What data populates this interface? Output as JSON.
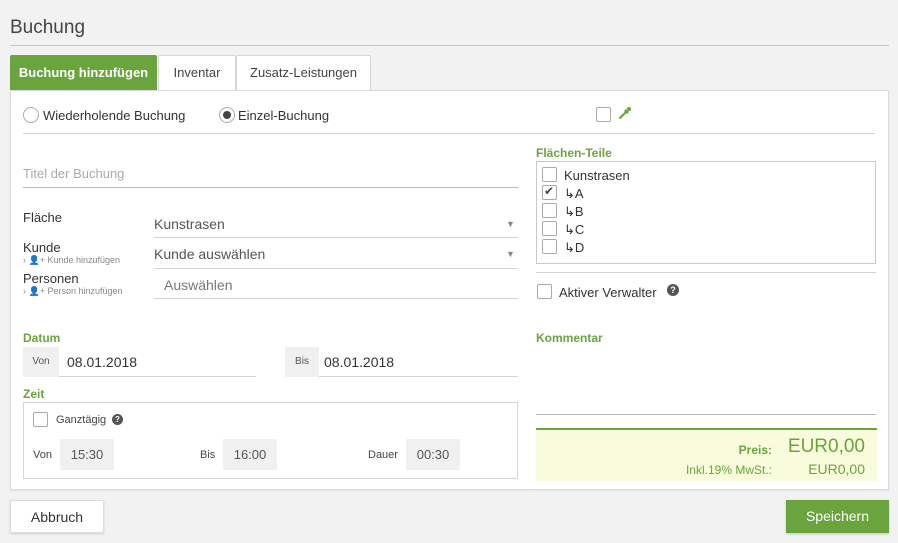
{
  "page": {
    "title": "Buchung"
  },
  "tabs": [
    {
      "label": "Buchung hinzufügen"
    },
    {
      "label": "Inventar"
    },
    {
      "label": "Zusatz-Leistungen"
    }
  ],
  "booking_type": {
    "recurring_label": "Wiederholende Buchung",
    "single_label": "Einzel-Buchung"
  },
  "title_field": {
    "placeholder": "Titel der Buchung"
  },
  "flaeche": {
    "label": "Fläche",
    "value": "Kunstrasen"
  },
  "kunde": {
    "label": "Kunde",
    "add_link": "Kunde hinzufügen",
    "value": "Kunde auswählen"
  },
  "personen": {
    "label": "Personen",
    "add_link": "Person hinzufügen",
    "placeholder": "Auswählen"
  },
  "datum": {
    "label": "Datum",
    "from_label": "Von",
    "from_value": "08.01.2018",
    "to_label": "Bis",
    "to_value": "08.01.2018"
  },
  "zeit": {
    "label": "Zeit",
    "allday_label": "Ganztägig",
    "from_label": "Von",
    "from_value": "15:30",
    "to_label": "Bis",
    "to_value": "16:00",
    "duration_label": "Dauer",
    "duration_value": "00:30"
  },
  "flaechen_teile": {
    "label": "Flächen-Teile",
    "items": [
      {
        "label": "Kunstrasen",
        "checked": false
      },
      {
        "label": "↳A",
        "checked": true
      },
      {
        "label": "↳B",
        "checked": false
      },
      {
        "label": "↳C",
        "checked": false
      },
      {
        "label": "↳D",
        "checked": false
      }
    ]
  },
  "aktiver_verwalter": {
    "label": "Aktiver Verwalter"
  },
  "kommentar": {
    "label": "Kommentar"
  },
  "preis": {
    "label": "Preis:",
    "value": "EUR0,00",
    "vat_label": "Inkl.19% MwSt.:",
    "vat_value": "EUR0,00"
  },
  "buttons": {
    "cancel": "Abbruch",
    "save": "Speichern"
  },
  "colors": {
    "accent": "#6aa43c",
    "price_bg": "#f8fbdc"
  }
}
